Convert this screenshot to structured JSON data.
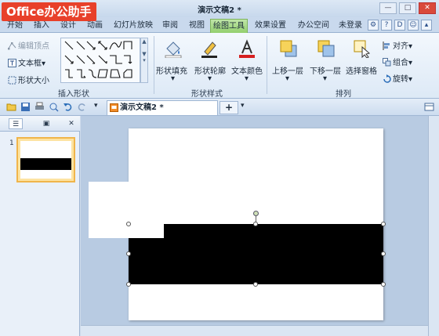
{
  "logo": "Office办公助手",
  "document_title": "演示文稿2 *",
  "window_buttons": {
    "minimize": "—",
    "maximize": "□",
    "close": "✕"
  },
  "menu_tabs": [
    {
      "label": "开始"
    },
    {
      "label": "插入"
    },
    {
      "label": "设计"
    },
    {
      "label": "动画"
    },
    {
      "label": "幻灯片放映"
    },
    {
      "label": "审阅"
    },
    {
      "label": "视图"
    },
    {
      "label": "绘图工具"
    },
    {
      "label": "效果设置"
    },
    {
      "label": "办公空间"
    }
  ],
  "login_label": "未登录",
  "ribbon": {
    "edit_vertex": "编辑顶点",
    "textbox": "文本框",
    "shape_size": "形状大小",
    "insert_shape_group": "插入形状",
    "shape_fill": "形状填充",
    "shape_outline": "形状轮廓",
    "text_color": "文本颜色",
    "shape_style_group": "形状样式",
    "bring_forward": "上移一层",
    "send_backward": "下移一层",
    "selection_pane": "选择窗格",
    "arrange_group": "排列",
    "align": "对齐",
    "group": "组合",
    "rotate": "旋转",
    "dropdown_arrow": "▾"
  },
  "doc_tab": {
    "title": "演示文稿2 *",
    "add_label": "+"
  },
  "left_pane": {
    "slide_number": "1",
    "close_label": "✕"
  },
  "colors": {
    "accent_green": "#93cf6e",
    "logo_red": "#e8402a",
    "selection_yellow": "#f0b54b"
  }
}
